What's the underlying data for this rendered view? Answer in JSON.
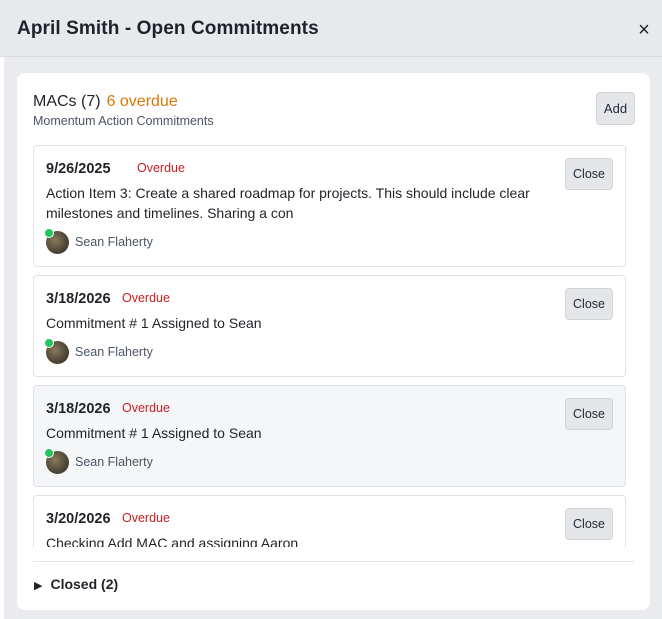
{
  "header": {
    "title": "April Smith - Open Commitments",
    "close_icon": "×"
  },
  "macs": {
    "title": "MACs (7)",
    "overdue_label": "6 overdue",
    "subtitle": "Momentum Action Commitments",
    "add_label": "Add"
  },
  "items": [
    {
      "date": "9/26/2025",
      "status": "Overdue",
      "text": "Action Item 3: Create a shared roadmap for projects. This should include clear milestones and timelines. Sharing a con",
      "assignee": "Sean Flaherty",
      "close_label": "Close"
    },
    {
      "date": "3/18/2026",
      "status": "Overdue",
      "text": "Commitment # 1 Assigned to Sean",
      "assignee": "Sean Flaherty",
      "close_label": "Close"
    },
    {
      "date": "3/18/2026",
      "status": "Overdue",
      "text": "Commitment # 1 Assigned to Sean",
      "assignee": "Sean Flaherty",
      "close_label": "Close"
    },
    {
      "date": "3/20/2026",
      "status": "Overdue",
      "text": "Checking Add MAC and assigning Aaron",
      "assignee": "",
      "close_label": "Close"
    }
  ],
  "closed": {
    "arrow_icon": "▶",
    "label": "Closed (2)"
  },
  "colors": {
    "overdue_count": "#d97706",
    "overdue_status": "#c81e1e",
    "online_badge": "#22c55e"
  }
}
